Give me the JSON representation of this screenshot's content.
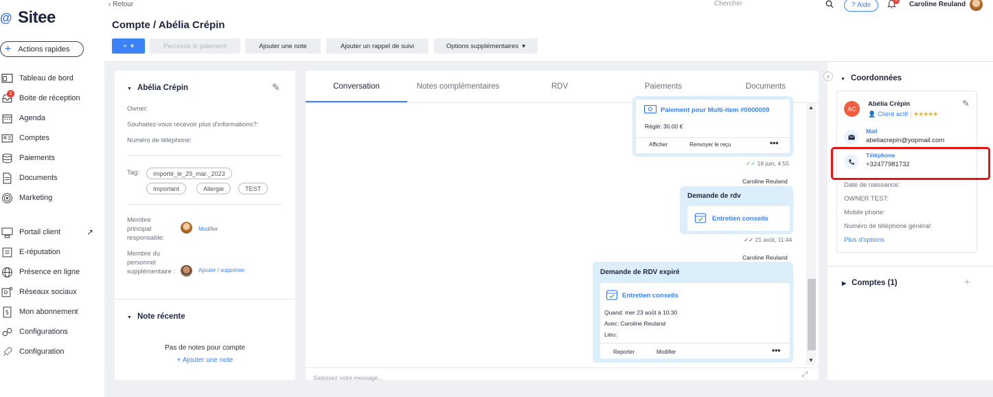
{
  "app": {
    "name": "Sitee"
  },
  "sidebar": {
    "quick_actions": "Actions rapides",
    "items": [
      {
        "label": "Tableau de bord",
        "icon": "dashboard-icon"
      },
      {
        "label": "Boite de réception",
        "icon": "inbox-icon",
        "badge": "1"
      },
      {
        "label": "Agenda",
        "icon": "calendar-icon"
      },
      {
        "label": "Comptes",
        "icon": "accounts-icon"
      },
      {
        "label": "Paiements",
        "icon": "coins-icon"
      },
      {
        "label": "Documents",
        "icon": "document-icon"
      },
      {
        "label": "Marketing",
        "icon": "target-icon"
      },
      {
        "label": "Portail client",
        "icon": "portal-icon"
      },
      {
        "label": "E-réputation",
        "icon": "review-icon"
      },
      {
        "label": "Présence en ligne",
        "icon": "globe-icon"
      },
      {
        "label": "Réseaux sociaux",
        "icon": "social-icon"
      },
      {
        "label": "Mon abonnement",
        "icon": "subscription-icon"
      },
      {
        "label": "Configurations",
        "icon": "gears-icon"
      },
      {
        "label": "Configuration",
        "icon": "rocket-icon"
      }
    ]
  },
  "header": {
    "back": "Retour",
    "title": "Compte / Abélia Crépin",
    "search_placeholder": "Chercher",
    "help": "Aide",
    "notifications": "3",
    "user_name": "Caroline Reuland",
    "buttons": {
      "plus": "+",
      "collect_payment": "Percevoir le paiement",
      "add_note": "Ajouter une note",
      "add_reminder": "Ajouter un rappel de suivi",
      "more_options": "Options supplémentaires"
    }
  },
  "left_panel": {
    "contact_name": "Abélia Crépin",
    "fields": {
      "owner": "Owner:",
      "info_question": "Souhaitez-vous recevoir plus d'informations?:",
      "phone": "Numéro de téléphone:"
    },
    "tag_label": "Tag:",
    "tags": [
      "importé_le_29_mar._2023",
      "Important",
      "Allergie",
      "TEST"
    ],
    "main_member_label": "Membre principal responsable:",
    "main_member_action": "Modifier",
    "extra_member_label": "Membre du personnel supplémentaire :",
    "extra_member_action": "Ajouter / supprimer",
    "recent_note_title": "Note récente",
    "no_notes": "Pas de notes pour compte",
    "add_note": "+ Ajouter une note"
  },
  "conversation": {
    "tabs": [
      "Conversation",
      "Notes complémentaires",
      "RDV",
      "Paiements",
      "Documents"
    ],
    "payment_card": {
      "title": "Paiement pour Multi-item #0000009",
      "status": "Réglé: 30.00 €",
      "action_view": "Afficher",
      "action_resend": "Renvoyer le reçu",
      "time": "18 juin, 4:55"
    },
    "rdv_card": {
      "author": "Caroline Reuland",
      "title": "Demande de rdv",
      "service": "Entretien conseils",
      "time": "21 août, 11:44"
    },
    "expired_card": {
      "author": "Caroline Reuland",
      "title": "Demande de RDV expiré",
      "service": "Entretien conseils",
      "when": "Quand:  mer 23 août à 10:30",
      "with": "Avec: Caroline Reuland",
      "place": "Lieu:",
      "action_postpone": "Reporter",
      "action_edit": "Modifier"
    },
    "input_placeholder": "Saisissez votre message..."
  },
  "right_panel": {
    "section_title": "Coordonnées",
    "initials": "AC",
    "name": "Abélia Crépin",
    "status": "Client actif",
    "rating": "★★★★★",
    "mail_label": "Mail",
    "mail_value": "abeliacrepin@yopmail.com",
    "phone_label": "Téléphone",
    "phone_value": "+32477981732",
    "other_fields": [
      "Date de naissance:",
      "OWNER TEST:",
      "Mobile phone:",
      "Numéro de téléphone général:"
    ],
    "more_options": "Plus d'options",
    "accounts_title": "Comptes (1)"
  },
  "colors": {
    "accent": "#3b82f6",
    "highlight": "#e11515",
    "card_bg": "#ddeefb"
  }
}
